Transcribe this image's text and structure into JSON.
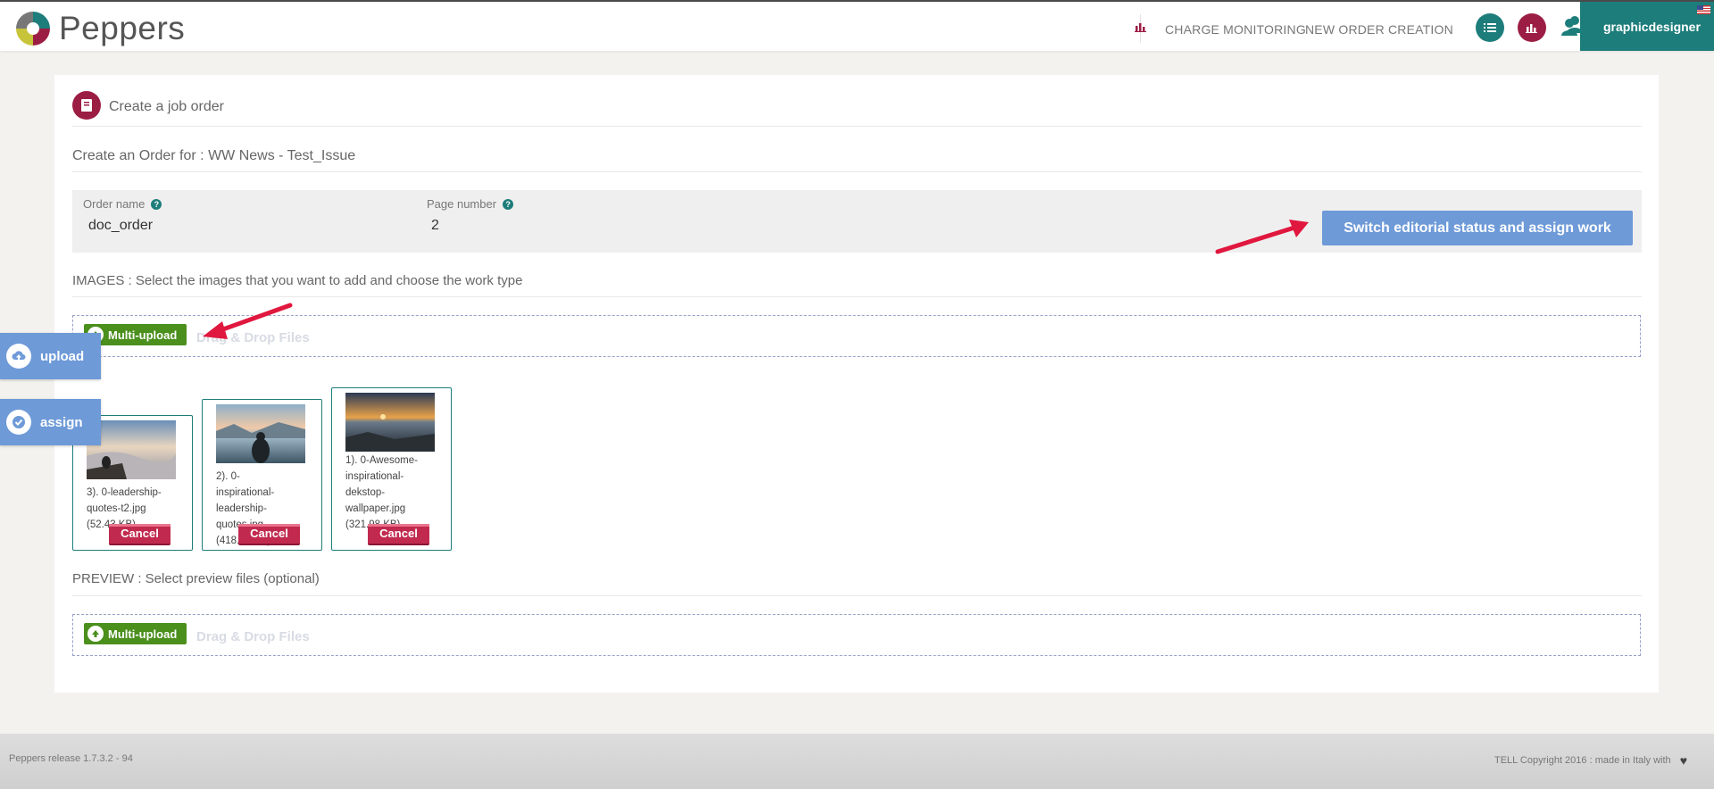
{
  "app": {
    "name": "Peppers"
  },
  "nav": {
    "charge_monitoring": "CHARGE MONITORING",
    "new_order_creation": "NEW ORDER CREATION",
    "user": "graphicdesigner"
  },
  "page": {
    "title": "Create a job order",
    "order_for": "Create an Order for : WW News - Test_Issue",
    "fields": {
      "order_name_label": "Order name",
      "order_name_value": "doc_order",
      "page_number_label": "Page number",
      "page_number_value": "2"
    },
    "switch_button": "Switch editorial status and assign work"
  },
  "images": {
    "section_label": "IMAGES : Select the images that you want to add and choose the work type",
    "multi_upload": "Multi-upload",
    "drag_drop": "Drag & Drop Files",
    "files": [
      {
        "text": "3). 0-leadership-quotes-t2.jpg (52.43 KB)",
        "cancel": "Cancel"
      },
      {
        "text": "2). 0-inspirational-leadership-quotes.jpg (418.91 KB)",
        "cancel": "Cancel"
      },
      {
        "text": "1). 0-Awesome-inspirational-dekstop-wallpaper.jpg (321.98 KB)",
        "cancel": "Cancel"
      }
    ]
  },
  "preview": {
    "section_label": "PREVIEW : Select preview files (optional)",
    "multi_upload": "Multi-upload",
    "drag_drop": "Drag & Drop Files"
  },
  "side": {
    "upload": "upload",
    "assign": "assign"
  },
  "footer": {
    "release": "Peppers release 1.7.3.2 - 94",
    "copyright": "TELL Copyright 2016 : made in Italy with"
  },
  "colors": {
    "accent_teal": "#1d7d7b",
    "accent_crimson": "#9c1d43",
    "button_blue": "#6e9ad8",
    "upload_green": "#4b8f1d",
    "cancel_red": "#c12a4e",
    "arrow_red": "#e0173e"
  }
}
